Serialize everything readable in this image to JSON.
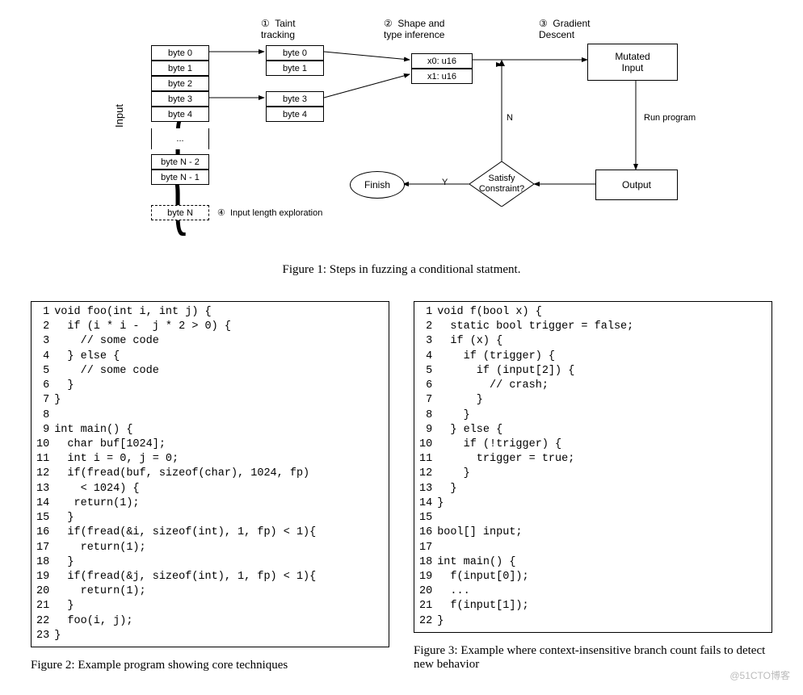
{
  "diagram": {
    "step1": "①  Taint\ntracking",
    "step2": "②  Shape and\ntype inference",
    "step3": "③  Gradient\nDescent",
    "step4": "④  Input length exploration",
    "input_label": "Input",
    "input_cells": [
      "byte 0",
      "byte 1",
      "byte 2",
      "byte 3",
      "byte 4",
      "...",
      "byte N - 2",
      "byte N - 1"
    ],
    "extra_cell": "byte N",
    "taint_cells": [
      "byte 0",
      "byte 1",
      "byte 3",
      "byte 4"
    ],
    "shape_cells": [
      "x0: u16",
      "x1: u16"
    ],
    "mutated": "Mutated\nInput",
    "run_program": "Run program",
    "output": "Output",
    "decision": "Satisfy\nConstraint?",
    "finish": "Finish",
    "yes": "Y",
    "no": "N"
  },
  "fig1_caption": "Figure 1: Steps in fuzzing a conditional statment.",
  "listing2": {
    "lines": [
      "void foo(int i, int j) {",
      "  if (i * i -  j * 2 > 0) {",
      "    // some code",
      "  } else {",
      "    // some code",
      "  }",
      "}",
      "",
      "int main() {",
      "  char buf[1024];",
      "  int i = 0, j = 0;",
      "  if(fread(buf, sizeof(char), 1024, fp)",
      "    < 1024) {",
      "   return(1);",
      "  }",
      "  if(fread(&i, sizeof(int), 1, fp) < 1){",
      "    return(1);",
      "  }",
      "  if(fread(&j, sizeof(int), 1, fp) < 1){",
      "    return(1);",
      "  }",
      "  foo(i, j);",
      "}"
    ],
    "caption": "Figure 2: Example program showing core techniques"
  },
  "listing3": {
    "lines": [
      "void f(bool x) {",
      "  static bool trigger = false;",
      "  if (x) {",
      "    if (trigger) {",
      "      if (input[2]) {",
      "        // crash;",
      "      }",
      "    }",
      "  } else {",
      "    if (!trigger) {",
      "      trigger = true;",
      "    }",
      "  }",
      "}",
      "",
      "bool[] input;",
      "",
      "int main() {",
      "  f(input[0]);",
      "  ...",
      "  f(input[1]);",
      "}"
    ],
    "caption": "Figure 3: Example where context-insensitive branch count fails to detect new behavior"
  },
  "watermark": "@51CTO博客"
}
